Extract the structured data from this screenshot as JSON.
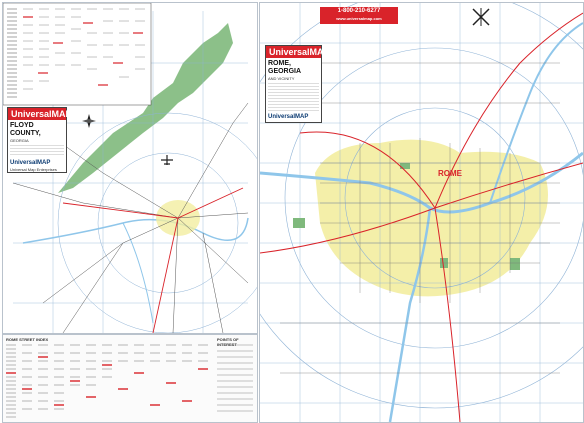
{
  "left_map": {
    "brand": "UniversalMAP",
    "title": "FLOYD COUNTY,",
    "subtitle": "GEORGIA",
    "footer_brand": "UniversalMAP",
    "footer_note": "Universal Map Enterprises"
  },
  "right_map": {
    "brand": "UniversalMAP",
    "title": "ROME, GEORGIA",
    "subtitle": "AND VICINITY",
    "footer_brand": "UniversalMAP",
    "phone": "1-800-210-6277",
    "website": "www.universalmap.com",
    "city_label": "ROME"
  },
  "index": {
    "heading_left": "ROME STREET INDEX",
    "heading_right": "POINTS OF INTEREST"
  },
  "colors": {
    "brand_red": "#d9232a",
    "park_green": "#7fb97c",
    "urban_yellow": "#f3eda0",
    "water_blue": "#8fc6ea",
    "grid_blue": "#8fb3d6"
  },
  "icons": {
    "compass": "compass-icon",
    "airport": "airplane-icon"
  }
}
